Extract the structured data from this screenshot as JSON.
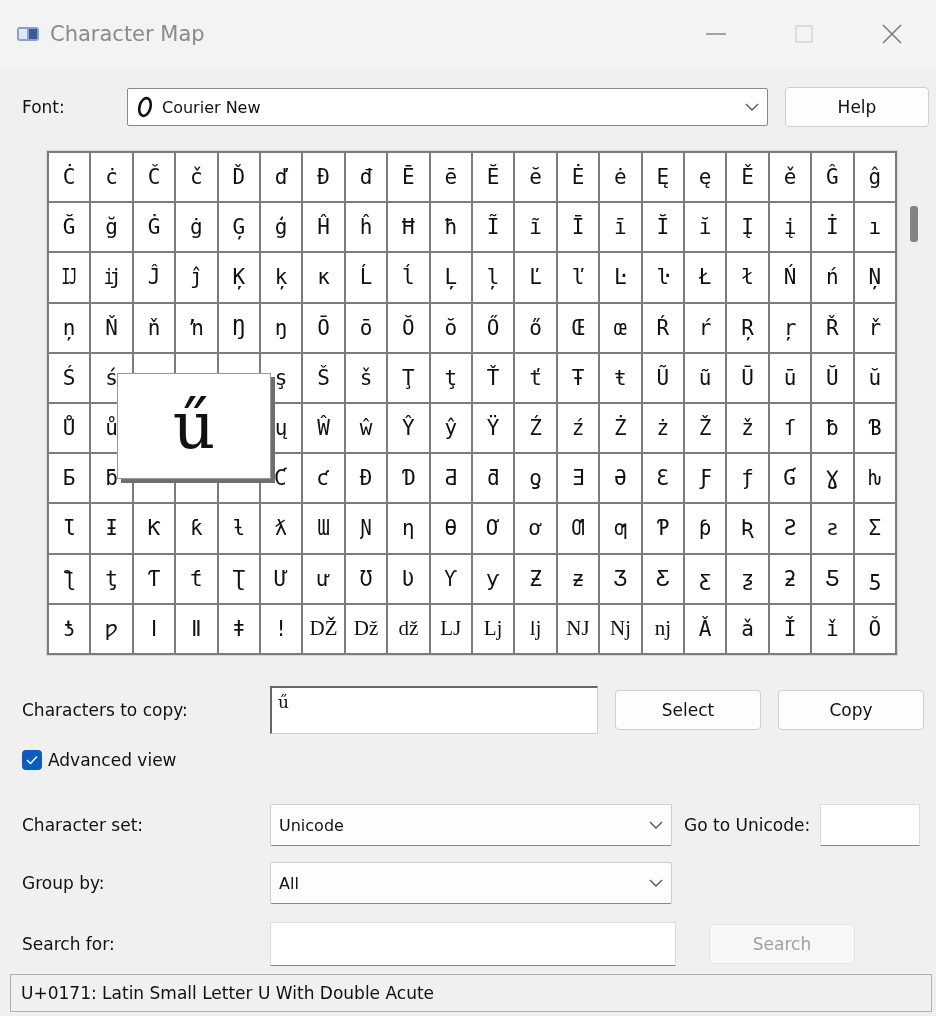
{
  "window": {
    "title": "Character Map"
  },
  "font": {
    "label": "Font:",
    "value": "Courier New"
  },
  "help_button": {
    "label": "Help"
  },
  "grid": {
    "rows": [
      [
        "Ċ",
        "ċ",
        "Č",
        "č",
        "Ď",
        "ď",
        "Đ",
        "đ",
        "Ē",
        "ē",
        "Ĕ",
        "ĕ",
        "Ė",
        "ė",
        "Ę",
        "ę",
        "Ě",
        "ě",
        "Ĝ",
        "ĝ"
      ],
      [
        "Ğ",
        "ğ",
        "Ġ",
        "ġ",
        "Ģ",
        "ģ",
        "Ĥ",
        "ĥ",
        "Ħ",
        "ħ",
        "Ĩ",
        "ĩ",
        "Ī",
        "ī",
        "Ĭ",
        "ĭ",
        "Į",
        "į",
        "İ",
        "ı"
      ],
      [
        "Ĳ",
        "ĳ",
        "Ĵ",
        "ĵ",
        "Ķ",
        "ķ",
        "ĸ",
        "Ĺ",
        "ĺ",
        "Ļ",
        "ļ",
        "Ľ",
        "ľ",
        "Ŀ",
        "ŀ",
        "Ł",
        "ł",
        "Ń",
        "ń",
        "Ņ"
      ],
      [
        "ņ",
        "Ň",
        "ň",
        "ŉ",
        "Ŋ",
        "ŋ",
        "Ō",
        "ō",
        "Ŏ",
        "ŏ",
        "Ő",
        "ő",
        "Œ",
        "œ",
        "Ŕ",
        "ŕ",
        "Ŗ",
        "ŗ",
        "Ř",
        "ř"
      ],
      [
        "Ś",
        "ś",
        null,
        null,
        null,
        "ş",
        "Š",
        "š",
        "Ţ",
        "ţ",
        "Ť",
        "ť",
        "Ŧ",
        "ŧ",
        "Ũ",
        "ũ",
        "Ū",
        "ū",
        "Ŭ",
        "ŭ"
      ],
      [
        "Ů",
        "ů",
        null,
        null,
        null,
        "ų",
        "Ŵ",
        "ŵ",
        "Ŷ",
        "ŷ",
        "Ÿ",
        "Ź",
        "ź",
        "Ż",
        "ż",
        "Ž",
        "ž",
        "ſ",
        "ƀ",
        "Ɓ"
      ],
      [
        "Ƃ",
        "ƃ",
        null,
        null,
        null,
        "Ƈ",
        "ƈ",
        "Ɖ",
        "Ɗ",
        "Ƌ",
        "ƌ",
        "ƍ",
        "Ǝ",
        "Ə",
        "Ɛ",
        "Ƒ",
        "ƒ",
        "Ɠ",
        "Ɣ",
        "ƕ"
      ],
      [
        "Ɩ",
        "Ɨ",
        "Ƙ",
        "ƙ",
        "ƚ",
        "ƛ",
        "Ɯ",
        "Ɲ",
        "ƞ",
        "Ɵ",
        "Ơ",
        "ơ",
        "Ƣ",
        "ƣ",
        "Ƥ",
        "ƥ",
        "Ʀ",
        "Ƨ",
        "ƨ",
        "Ʃ"
      ],
      [
        "ƪ",
        "ƫ",
        "Ƭ",
        "ƭ",
        "Ʈ",
        "Ư",
        "ư",
        "Ʊ",
        "Ʋ",
        "Ƴ",
        "ƴ",
        "Ƶ",
        "ƶ",
        "Ʒ",
        "Ƹ",
        "ƹ",
        "ƺ",
        "ƻ",
        "Ƽ",
        "ƽ"
      ],
      [
        "ƾ",
        "ƿ",
        "ǀ",
        "ǁ",
        "ǂ",
        "ǃ",
        "Ǆ",
        "ǅ",
        "ǆ",
        "Ǉ",
        "ǈ",
        "ǉ",
        "Ǌ",
        "ǋ",
        "ǌ",
        "Ǎ",
        "ǎ",
        "Ǐ",
        "ǐ",
        "Ǒ"
      ]
    ],
    "magnified": "ű"
  },
  "copy_field": {
    "label": "Characters to copy:",
    "value": "ű"
  },
  "select_button": {
    "label": "Select"
  },
  "copy_button": {
    "label": "Copy"
  },
  "advanced_view": {
    "label": "Advanced view",
    "checked": true
  },
  "character_set": {
    "label": "Character set:",
    "value": "Unicode"
  },
  "go_to_unicode": {
    "label": "Go to Unicode:"
  },
  "group_by": {
    "label": "Group by:",
    "value": "All"
  },
  "search_field": {
    "label": "Search for:"
  },
  "search_button": {
    "label": "Search",
    "disabled": true
  },
  "status_bar": {
    "text": "U+0171: Latin Small Letter U With Double Acute"
  }
}
